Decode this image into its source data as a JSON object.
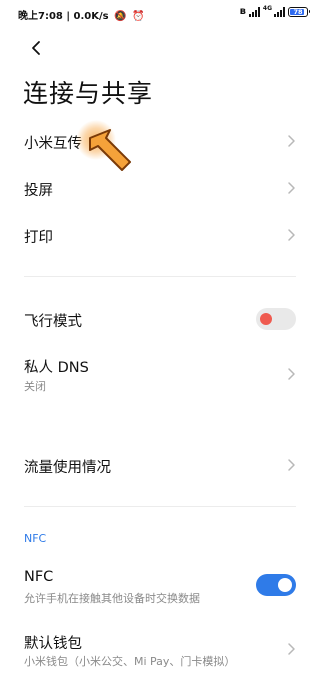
{
  "status_bar": {
    "time": "晚上7:08",
    "speed": "0.0K/s",
    "battery_level": "78",
    "network_tag": "4G"
  },
  "page": {
    "title": "连接与共享"
  },
  "items": {
    "mi_share": {
      "label": "小米互传"
    },
    "cast": {
      "label": "投屏"
    },
    "print": {
      "label": "打印"
    },
    "airplane": {
      "label": "飞行模式",
      "on": false
    },
    "dns": {
      "label": "私人 DNS",
      "value": "关闭"
    },
    "data_usage": {
      "label": "流量使用情况"
    },
    "nfc": {
      "label": "NFC",
      "description": "允许手机在接触其他设备时交换数据",
      "on": true
    },
    "wallet": {
      "label": "默认钱包",
      "value": "小米钱包（小米公交、Mi Pay、门卡模拟）"
    }
  },
  "sections": {
    "nfc_header": "NFC"
  },
  "colors": {
    "accent": "#2f7be8",
    "toggle_off_knob": "#ef5a4f",
    "tap_indicator": "#f5a23a"
  }
}
